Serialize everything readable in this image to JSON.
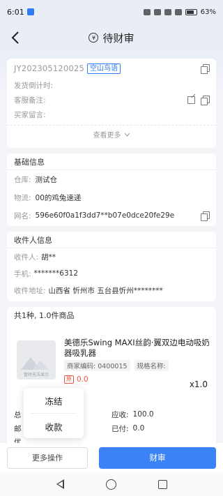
{
  "status": {
    "time": "6:01",
    "battery": "63%"
  },
  "header": {
    "title": "待财审"
  },
  "order": {
    "order_no": "JY202305120025",
    "shop_tag": "空山鸟语",
    "fields": [
      {
        "label": "发货倒计时:",
        "value": ""
      },
      {
        "label": "客服备注:",
        "value": ""
      },
      {
        "label": "买家留言:",
        "value": ""
      }
    ],
    "see_more": "查看更多"
  },
  "basic": {
    "title": "基础信息",
    "warehouse_label": "仓库:",
    "warehouse": "测试仓",
    "logistics_label": "物流:",
    "logistics": "00的鸡兔速递",
    "nick_label": "网名:",
    "nick": "596e60f0a1f3dd7**b07e0dce20fe29e"
  },
  "receiver": {
    "title": "收件人信息",
    "name_label": "收件人:",
    "name": "胡**",
    "phone_label": "手机:",
    "phone": "*******6312",
    "address_label": "收件地址:",
    "address": "山西省 忻州市 五台县忻州********"
  },
  "goods": {
    "summary": "共1种, 1.0件商品",
    "name": "美德乐Swing MAXI丝韵·翼双边电动吸奶器吸乳器",
    "code_tag": "商家编码: 0400015",
    "spec_tag": "规格名称:",
    "price_mark": "原",
    "price": "0.0",
    "qty": "x1.0",
    "img_caption": "暂时无法显示"
  },
  "totals": {
    "left1": "总",
    "left2": "邮",
    "left3": "优",
    "receivable_label": "应收:",
    "receivable": "100.0",
    "paid_label": "已付:",
    "paid": "0.0"
  },
  "popup": {
    "items": [
      "冻结",
      "收款"
    ]
  },
  "bottom": {
    "more": "更多操作",
    "primary": "财审"
  }
}
